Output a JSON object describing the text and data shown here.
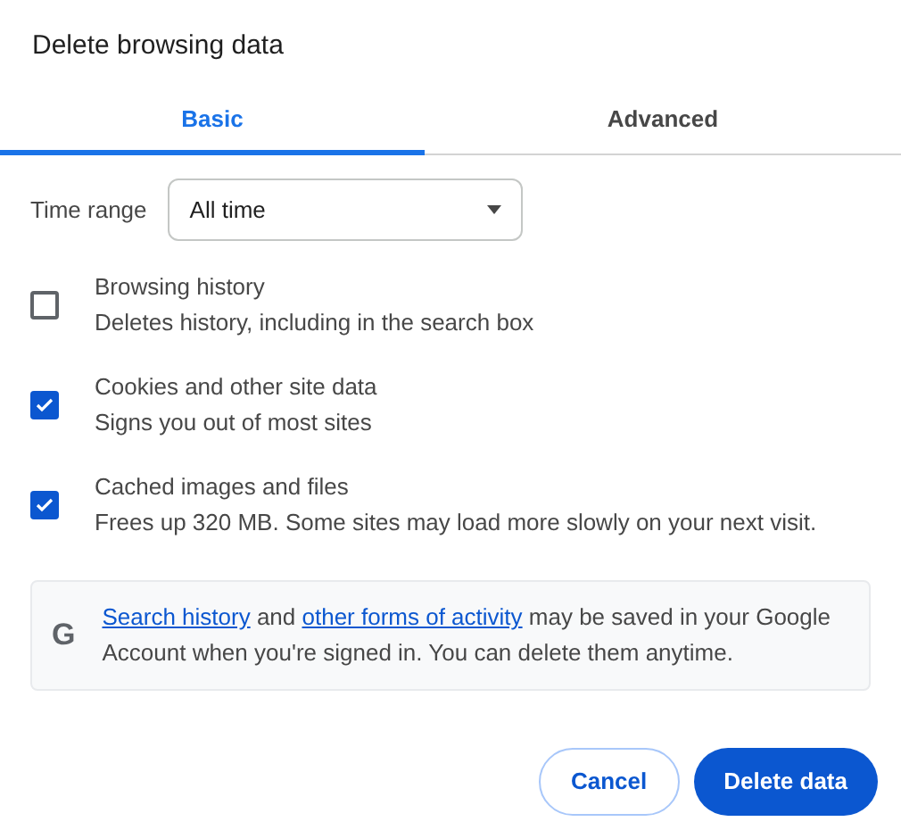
{
  "dialog": {
    "title": "Delete browsing data"
  },
  "tabs": [
    {
      "label": "Basic",
      "selected": true
    },
    {
      "label": "Advanced",
      "selected": false
    }
  ],
  "time_range": {
    "label": "Time range",
    "value": "All time"
  },
  "options": [
    {
      "title": "Browsing history",
      "description": "Deletes history, including in the search box",
      "checked": false
    },
    {
      "title": "Cookies and other site data",
      "description": "Signs you out of most sites",
      "checked": true
    },
    {
      "title": "Cached images and files",
      "description": "Frees up 320 MB. Some sites may load more slowly on your next visit.",
      "checked": true
    }
  ],
  "info": {
    "logo": "G",
    "parts": [
      {
        "text": "Search history",
        "link": true
      },
      {
        "text": " and ",
        "link": false
      },
      {
        "text": "other forms of activity",
        "link": true
      },
      {
        "text": " may be saved in your Google Account when you're signed in. You can delete them anytime.",
        "link": false
      }
    ]
  },
  "buttons": [
    {
      "label": "Cancel",
      "kind": "secondary"
    },
    {
      "label": "Delete data",
      "kind": "primary"
    }
  ]
}
